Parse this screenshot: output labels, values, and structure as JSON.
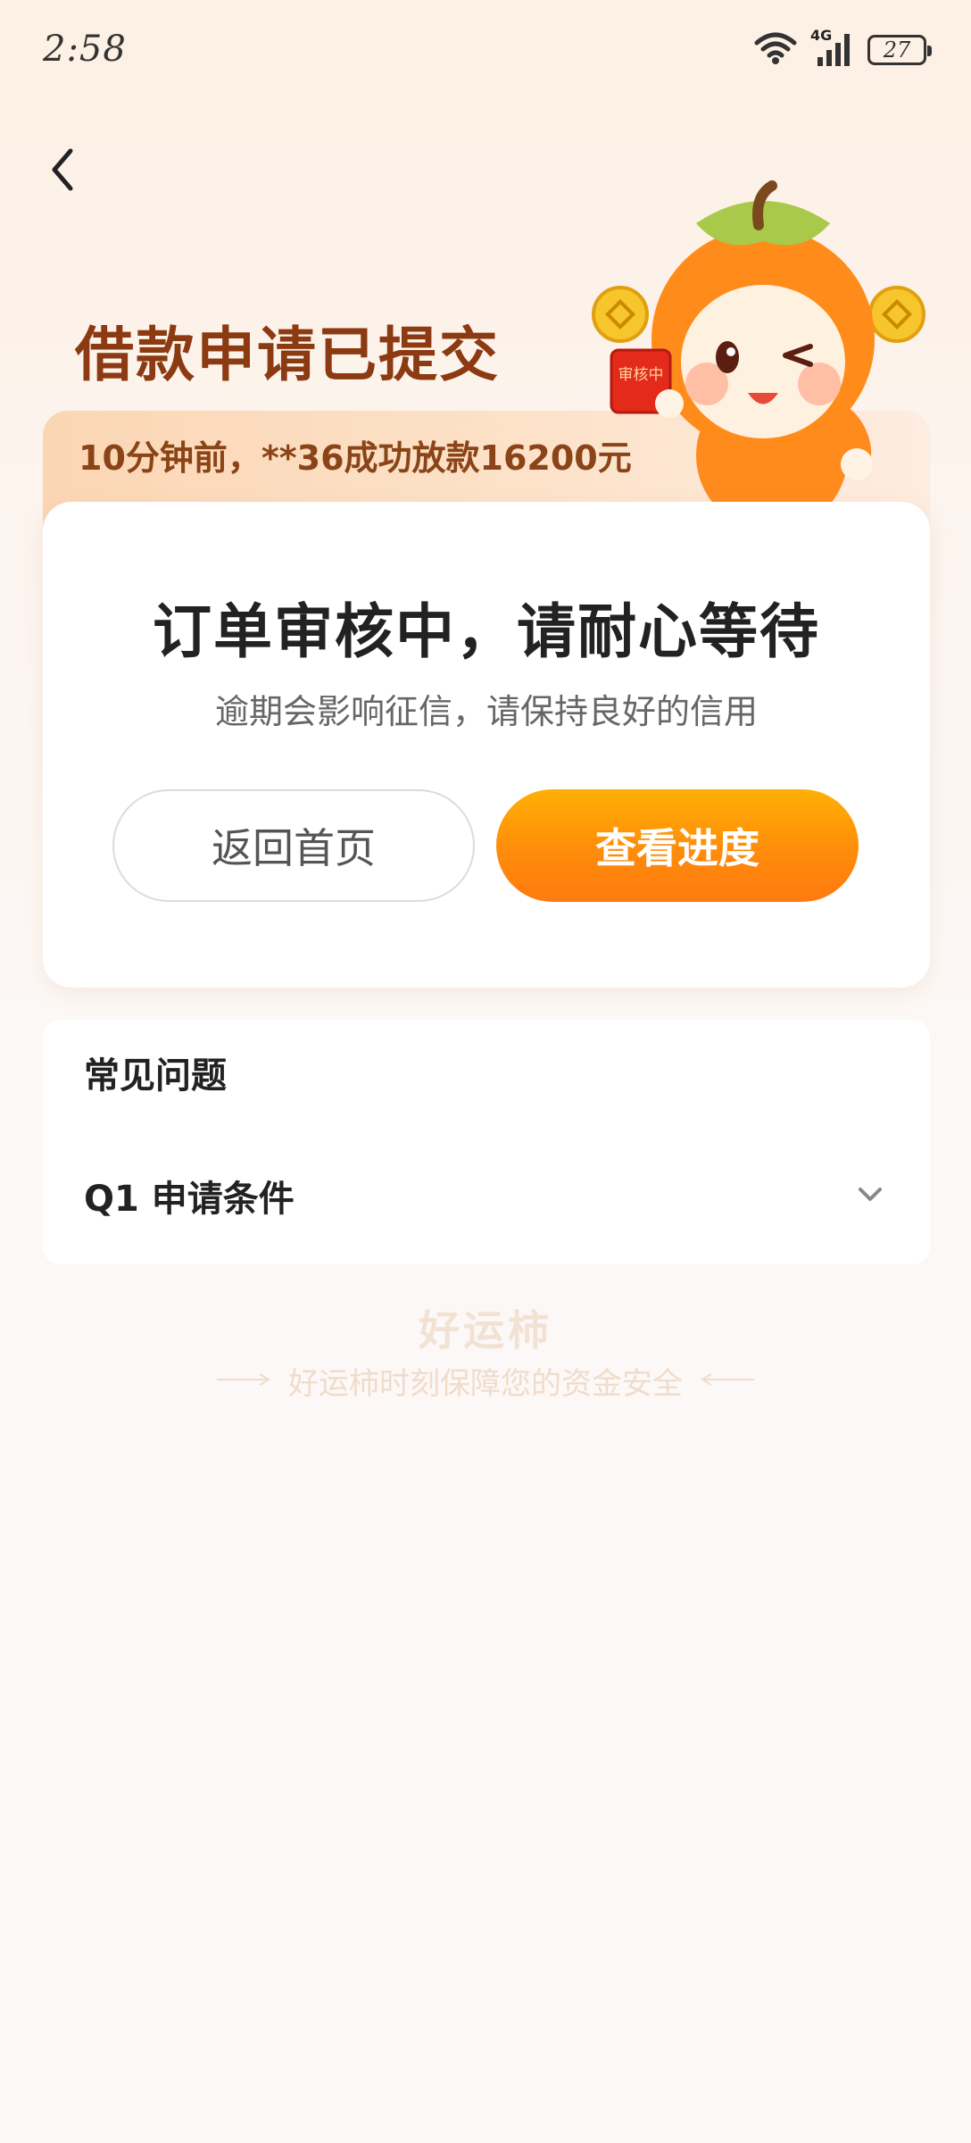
{
  "status_bar": {
    "time": "2:58",
    "network": "4G",
    "battery": "27"
  },
  "header": {
    "title": "借款申请已提交"
  },
  "ticker": {
    "text": "10分钟前，**36成功放款16200元"
  },
  "mascot": {
    "badge_text": "审核中"
  },
  "main_card": {
    "heading": "订单审核中，请耐心等待",
    "subtext": "逾期会影响征信，请保持良好的信用",
    "home_button": "返回首页",
    "progress_button": "查看进度"
  },
  "faq": {
    "title": "常见问题",
    "items": [
      {
        "label": "Q1 申请条件"
      }
    ]
  },
  "footer": {
    "brand": "好运柿",
    "slogan": "好运柿时刻保障您的资金安全"
  },
  "colors": {
    "title_brown": "#8b3a12",
    "accent_orange": "#ff8c0a",
    "ticker_bg": "#fbd6b4"
  }
}
